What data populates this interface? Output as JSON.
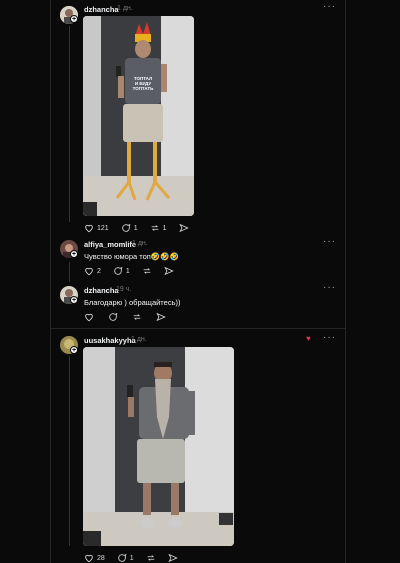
{
  "posts": [
    {
      "username": "dzhancha",
      "time": "1 дн.",
      "stats": {
        "likes": "121",
        "comments": "1",
        "reposts": "1"
      },
      "shirt_text": "ТОПТАЛ\nИ БУДУ\nТОПТАТЬ"
    },
    {
      "username": "uusakhakyyha",
      "time": "1 дн.",
      "stats": {
        "likes": "28",
        "comments": "1"
      }
    }
  ],
  "replies": [
    {
      "username": "alfiya_momlife",
      "time": "1 дн.",
      "text": "Чувство юмора топ🤣🤣🤣",
      "stats": {
        "likes": "2",
        "comments": "1"
      }
    },
    {
      "username": "dzhancha",
      "time": "19 ч.",
      "text": "Благодарю ) обращайтесь))"
    }
  ],
  "icons": [
    "heart-icon",
    "comment-icon",
    "repost-icon",
    "share-icon",
    "more-icon",
    "follow-plus-icon"
  ],
  "colors": {
    "background": "#0a0a0a",
    "text": "#f3f5f7",
    "muted": "#777777",
    "border": "#262626"
  }
}
